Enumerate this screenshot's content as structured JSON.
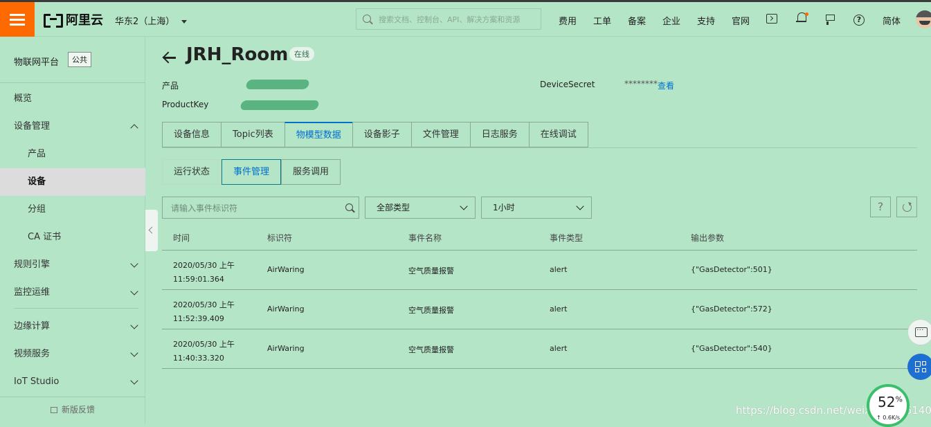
{
  "topbar": {
    "logo_text": "阿里云",
    "region": "华东2（上海）",
    "search_placeholder": "搜索文档、控制台、API、解决方案和资源",
    "links": [
      "费用",
      "工单",
      "备案",
      "企业",
      "支持",
      "官网"
    ],
    "language": "简体",
    "accent_color": "#ff6a00"
  },
  "sidebar": {
    "title": "物联网平台",
    "badge": "公共",
    "items": [
      {
        "label": "概览"
      },
      {
        "label": "设备管理"
      },
      {
        "label": "产品"
      },
      {
        "label": "设备"
      },
      {
        "label": "分组"
      },
      {
        "label": "CA 证书"
      },
      {
        "label": "规则引擎"
      },
      {
        "label": "监控运维"
      },
      {
        "label": "边缘计算"
      },
      {
        "label": "视频服务"
      },
      {
        "label": "IoT Studio"
      }
    ],
    "feedback": "新版反馈"
  },
  "device": {
    "name": "JRH_Room",
    "status": "在线",
    "product_label": "产品",
    "productkey_label": "ProductKey",
    "secret_label": "DeviceSecret",
    "secret_value": "********",
    "view_link": "查看"
  },
  "tabs": [
    "设备信息",
    "Topic列表",
    "物模型数据",
    "设备影子",
    "文件管理",
    "日志服务",
    "在线调试"
  ],
  "subtabs": [
    "运行状态",
    "事件管理",
    "服务调用"
  ],
  "filters": {
    "search_placeholder": "请输入事件标识符",
    "type_value": "全部类型",
    "time_value": "1小时",
    "help_label": "?"
  },
  "table": {
    "headers": [
      "时间",
      "标识符",
      "事件名称",
      "事件类型",
      "输出参数"
    ],
    "rows": [
      {
        "date": "2020/05/30 上午",
        "time": "11:59:01.364",
        "identifier": "AirWaring",
        "name": "空气质量报警",
        "type": "alert",
        "output": "{\"GasDetector\":501}"
      },
      {
        "date": "2020/05/30 上午",
        "time": "11:52:39.409",
        "identifier": "AirWaring",
        "name": "空气质量报警",
        "type": "alert",
        "output": "{\"GasDetector\":572}"
      },
      {
        "date": "2020/05/30 上午",
        "time": "11:40:33.320",
        "identifier": "AirWaring",
        "name": "空气质量报警",
        "type": "alert",
        "output": "{\"GasDetector\":540}"
      }
    ]
  },
  "overlay": {
    "speed_percent": "52",
    "speed_unit": "%",
    "speed_rate": "↑ 0.6K/s",
    "watermark": "https://blog.csdn.net/weixin_4436140"
  }
}
